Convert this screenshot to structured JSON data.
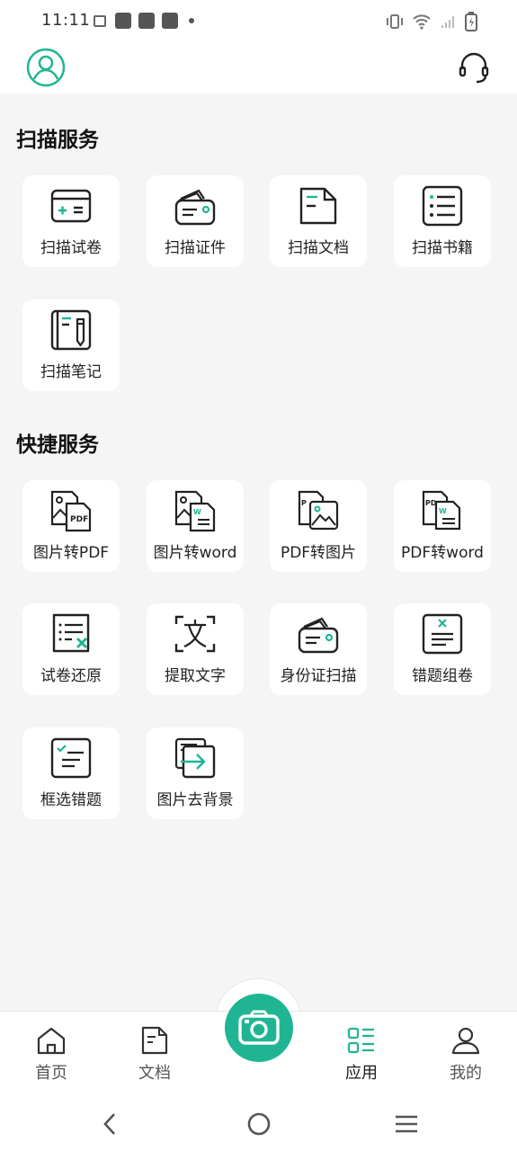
{
  "status_bar": {
    "time": "11:11"
  },
  "colors": {
    "accent": "#1fb593",
    "background": "#f5f5f5",
    "card": "#ffffff",
    "text": "#111111"
  },
  "sections": [
    {
      "title": "扫描服务",
      "items": [
        {
          "label": "扫描试卷",
          "icon": "exam-scan-icon"
        },
        {
          "label": "扫描证件",
          "icon": "id-card-scan-icon"
        },
        {
          "label": "扫描文档",
          "icon": "document-scan-icon"
        },
        {
          "label": "扫描书籍",
          "icon": "book-list-icon"
        },
        {
          "label": "扫描笔记",
          "icon": "notebook-pen-icon"
        }
      ]
    },
    {
      "title": "快捷服务",
      "items": [
        {
          "label": "图片转PDF",
          "icon": "image-to-pdf-icon"
        },
        {
          "label": "图片转word",
          "icon": "image-to-word-icon"
        },
        {
          "label": "PDF转图片",
          "icon": "pdf-to-image-icon"
        },
        {
          "label": "PDF转word",
          "icon": "pdf-to-word-icon"
        },
        {
          "label": "试卷还原",
          "icon": "exam-restore-icon"
        },
        {
          "label": "提取文字",
          "icon": "extract-text-icon"
        },
        {
          "label": "身份证扫描",
          "icon": "id-card-scan-icon"
        },
        {
          "label": "错题组卷",
          "icon": "wrong-question-paper-icon"
        },
        {
          "label": "框选错题",
          "icon": "select-wrong-question-icon"
        },
        {
          "label": "图片去背景",
          "icon": "remove-background-icon"
        }
      ]
    }
  ],
  "bottom_nav": [
    {
      "label": "首页",
      "icon": "home-icon",
      "active": false
    },
    {
      "label": "文档",
      "icon": "document-icon",
      "active": false
    },
    {
      "label": "应用",
      "icon": "apps-icon",
      "active": true
    },
    {
      "label": "我的",
      "icon": "user-icon",
      "active": false
    }
  ],
  "camera_button_icon": "camera-icon"
}
